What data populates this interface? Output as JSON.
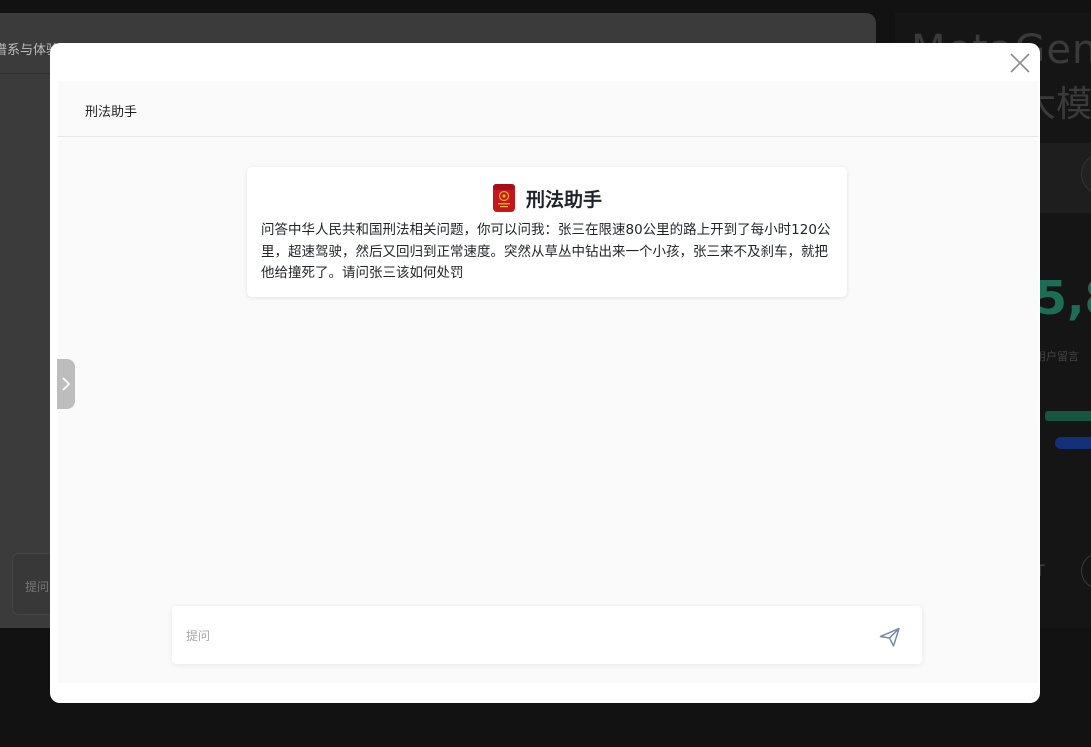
{
  "background": {
    "left_title": "谱系与体验",
    "left_input_placeholder": "提问",
    "right_big_text": "MetaGen",
    "right_big_text2": "大模",
    "right_number": "5,8",
    "right_small_text": "用户留言",
    "right_t": "T"
  },
  "modal": {
    "header_title": "刑法助手",
    "card": {
      "name": "刑法助手",
      "description": "问答中华人民共和国刑法相关问题，你可以问我：张三在限速80公里的路上开到了每小时120公里，超速驾驶，然后又回归到正常速度。突然从草丛中钻出来一个小孩，张三来不及刹车，就把他给撞死了。请问张三该如何处罚"
    },
    "input": {
      "placeholder": "提问",
      "value": ""
    }
  },
  "colors": {
    "logo_red": "#c8161d",
    "logo_gold": "#e8b923",
    "send_icon": "#7a8aa5"
  },
  "icons": [
    "close-icon",
    "chevron-right-icon",
    "emblem-logo-icon",
    "send-icon"
  ]
}
